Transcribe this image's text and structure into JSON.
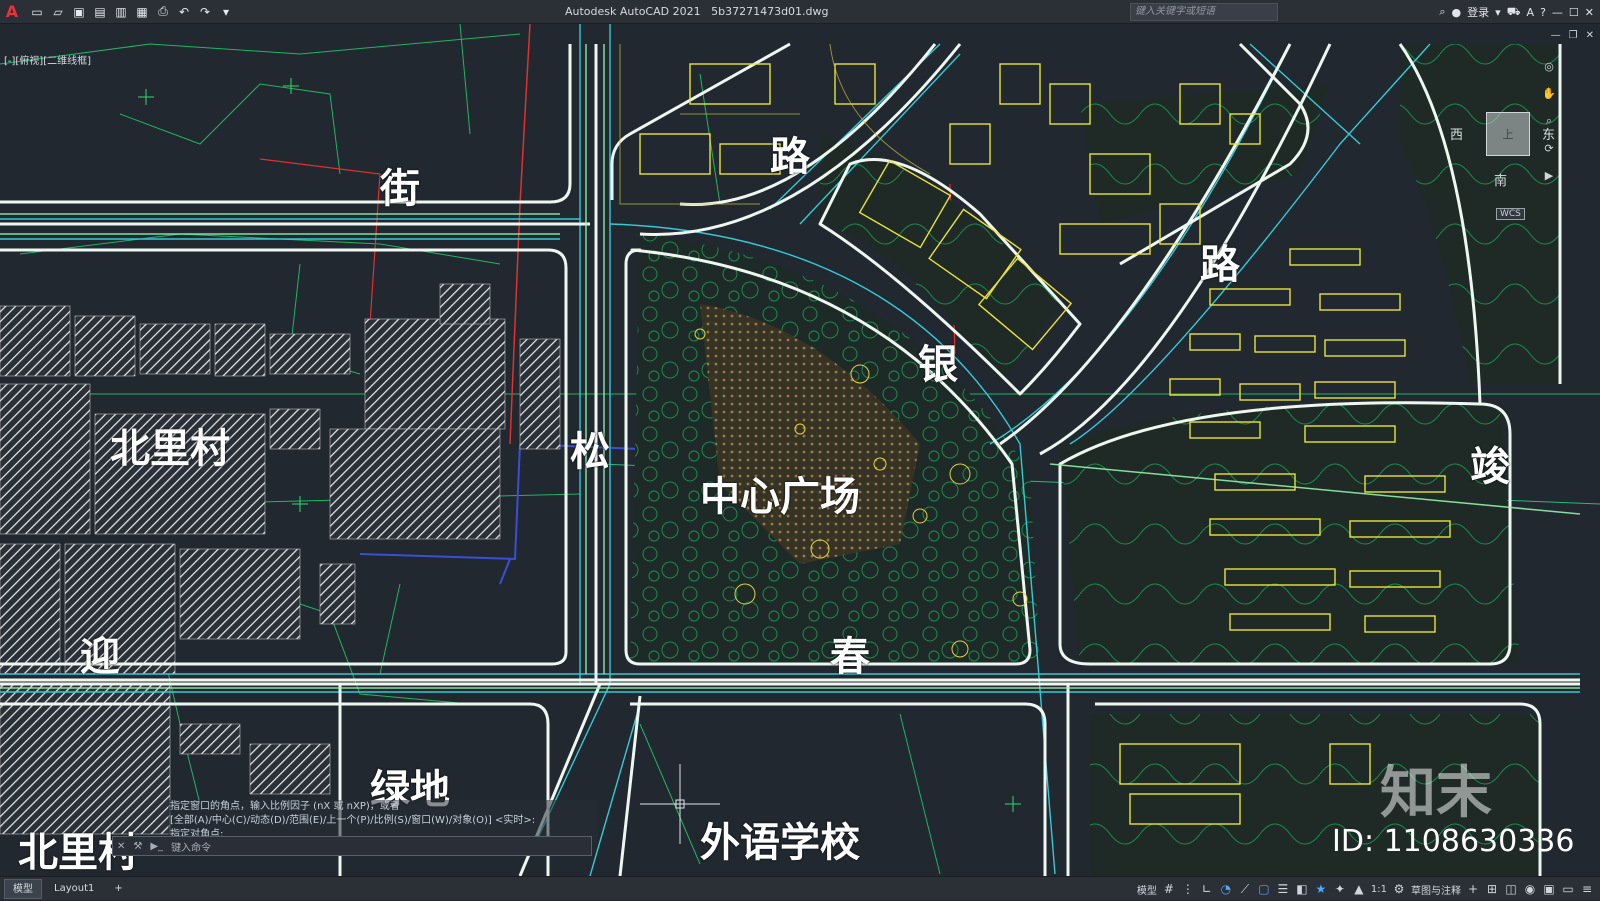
{
  "app": {
    "title": "Autodesk AutoCAD 2021",
    "file": "5b37271473d01.dwg",
    "search_placeholder": "键入关键字或短语",
    "login_label": "登录",
    "logo_letter": "A"
  },
  "quick_access": [
    "new-icon",
    "open-icon",
    "save-icon",
    "saveas-icon",
    "plot-icon",
    "publish-icon",
    "print-icon",
    "undo-icon",
    "redo-icon"
  ],
  "viewport": {
    "label": "[-][俯视][二维线框]"
  },
  "map_labels": {
    "street_jie": "街",
    "road_lu1": "路",
    "road_lu2": "路",
    "yin": "银",
    "jun": "竣",
    "beilicun1": "北里村",
    "beilicun2": "北里村",
    "song": "松",
    "center_square": "中心广场",
    "chun": "春",
    "ying": "迎",
    "lvdi": "绿地",
    "school": "外语学校"
  },
  "viewcube": {
    "top": "上",
    "west": "西",
    "east": "东",
    "south": "南",
    "wcs": "WCS"
  },
  "command": {
    "history": [
      "指定窗口的角点，输入比例因子 (nX 或 nXP)，或者",
      "[全部(A)/中心(C)/动态(D)/范围(E)/上一个(P)/比例(S)/窗口(W)/对象(O)] <实时>:",
      "指定对角点:"
    ],
    "input_placeholder": "键入命令"
  },
  "watermark": {
    "brand": "知末",
    "id": "ID: 1108630336"
  },
  "status": {
    "tabs": [
      "模型",
      "Layout1"
    ],
    "model_label": "模型",
    "scale": "1:1",
    "workspace": "草图与注释"
  },
  "colors": {
    "background": "#212830",
    "road": "#e8f4ea",
    "green_line": "#1fd36a",
    "cyan_line": "#36c9d6",
    "yellow_building": "#e8e33a",
    "red_line": "#e0322e",
    "blue_line": "#3b4fd6"
  }
}
